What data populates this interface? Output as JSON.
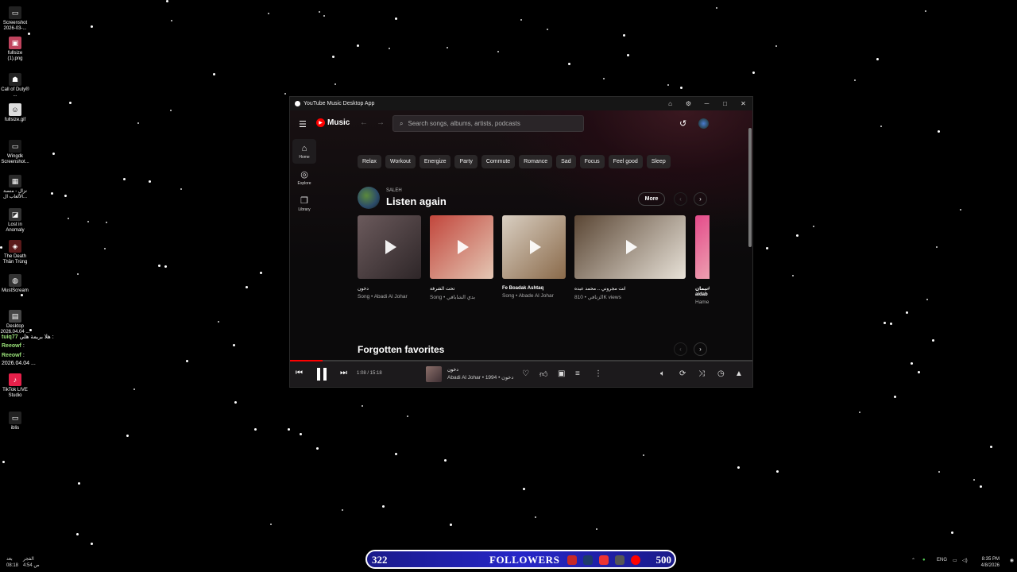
{
  "desktop": {
    "items": [
      {
        "label": "Screenshot 2026-03-..."
      },
      {
        "label": "fullsize (1).png"
      },
      {
        "label": "Call of Duty® ..."
      },
      {
        "label": "fullsize.gif"
      },
      {
        "label": "Wingdk Screenshot..."
      },
      {
        "label": "نزال - منصة الألعاب ال..."
      },
      {
        "label": "Lost in Anomaly"
      },
      {
        "label": "The Death Thần Trùng"
      },
      {
        "label": "MustScream"
      },
      {
        "label": "Desktop 2026.04.04 ..."
      },
      {
        "label": "TikTok LIVE Studio"
      },
      {
        "label": "iblis"
      }
    ],
    "chat": [
      {
        "user": "tuiq77",
        "text": "هلا بريمة هلي :"
      },
      {
        "user": "Reeowf",
        "text": ":"
      },
      {
        "user": "Reeowf",
        "text": ":"
      },
      {
        "user": "",
        "text": "2026.04.04 ..."
      }
    ]
  },
  "window": {
    "title": "YouTube Music Desktop App"
  },
  "app": {
    "logo": "Music",
    "search_placeholder": "Search songs, albums, artists, podcasts",
    "sidebar": [
      {
        "label": "Home"
      },
      {
        "label": "Explore"
      },
      {
        "label": "Library"
      }
    ],
    "chips": [
      "Relax",
      "Workout",
      "Energize",
      "Party",
      "Commute",
      "Romance",
      "Sad",
      "Focus",
      "Feel good",
      "Sleep"
    ],
    "section1": {
      "user": "SALEH",
      "title": "Listen again",
      "more": "More"
    },
    "cards": [
      {
        "title": "دخون",
        "sub": "Song • Abadi Al Johar",
        "colors": [
          "#6b5a5c",
          "#2e2628"
        ],
        "bold": false
      },
      {
        "title": "تحت الشرفة",
        "sub": "Song • بدي الشابافي",
        "colors": [
          "#c2463c",
          "#e4c7b4"
        ],
        "bold": false
      },
      {
        "title": "Fe Boadak Ashtaq",
        "sub": "Song • Abade Al Johar",
        "colors": [
          "#d9cfc2",
          "#8a6a4a"
        ],
        "bold": true
      },
      {
        "title": "انت مجروني .. محمد عبده",
        "sub": "الزنافي • 810K views",
        "colors": [
          "#5a4634",
          "#e8e2d8"
        ],
        "bold": false
      },
      {
        "title": "نيمان#",
        "sub": "Hame",
        "title2": "aidab",
        "colors": [
          "#e44a8a",
          "#f2d6c8"
        ],
        "bold": true
      }
    ],
    "section2": {
      "title": "Forgotten favorites"
    }
  },
  "player": {
    "time": "1:08 / 15:18",
    "progress": 0.07,
    "track_title": "دخون",
    "track_sub": "Abadi Al Johar • دخون • 1994"
  },
  "taskbar": {
    "followers_left": "322",
    "followers_label": "FOLLOWERS",
    "followers_right": "500",
    "lang": "ENG",
    "time": "8:35 PM",
    "date": "4/8/2026",
    "corner_a": "بعد",
    "corner_a2": "08:18",
    "corner_b": "الفجر",
    "corner_b2": "4:54 ص"
  }
}
